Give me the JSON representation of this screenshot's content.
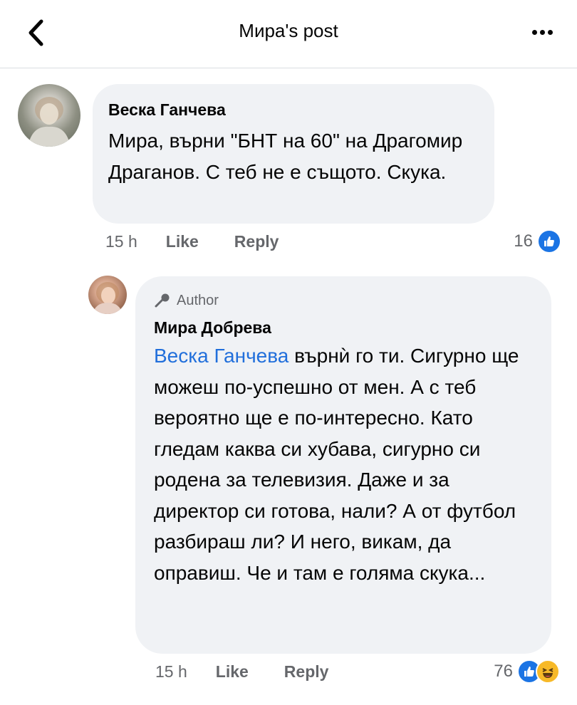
{
  "header": {
    "title": "Мира's post",
    "back_icon": "chevron-left-icon",
    "more_icon": "more-horizontal-icon"
  },
  "comments": [
    {
      "author": "Веска Ганчева",
      "text": "Мира, върни \"БНТ на 60\" на Драгомир Драганов. С теб не е същото. Скука.",
      "time": "15 h",
      "like_label": "Like",
      "reply_label": "Reply",
      "reaction_count": "16",
      "reactions": [
        "like-icon"
      ]
    },
    {
      "badge": "Author",
      "author": "Мира Добрева",
      "mention": "Веска Ганчева",
      "text": " върнѝ го ти. Сигурно ще можеш по-успешно от мен. А с теб вероятно ще е по-интересно. Като гледам каква си хубава, сигурно си родена за телевизия. Даже и за директор си готова, нали? А от футбол разбираш ли? И него, викам, да оправиш. Че и там е голяма скука...",
      "time": "15 h",
      "like_label": "Like",
      "reply_label": "Reply",
      "reaction_count": "76",
      "reactions": [
        "like-icon",
        "haha-icon"
      ]
    }
  ],
  "colors": {
    "mention": "#216fdb",
    "bubble": "#f0f2f5",
    "like": "#1b74e4",
    "haha": "#f7b928",
    "secondary_text": "#65676b"
  }
}
